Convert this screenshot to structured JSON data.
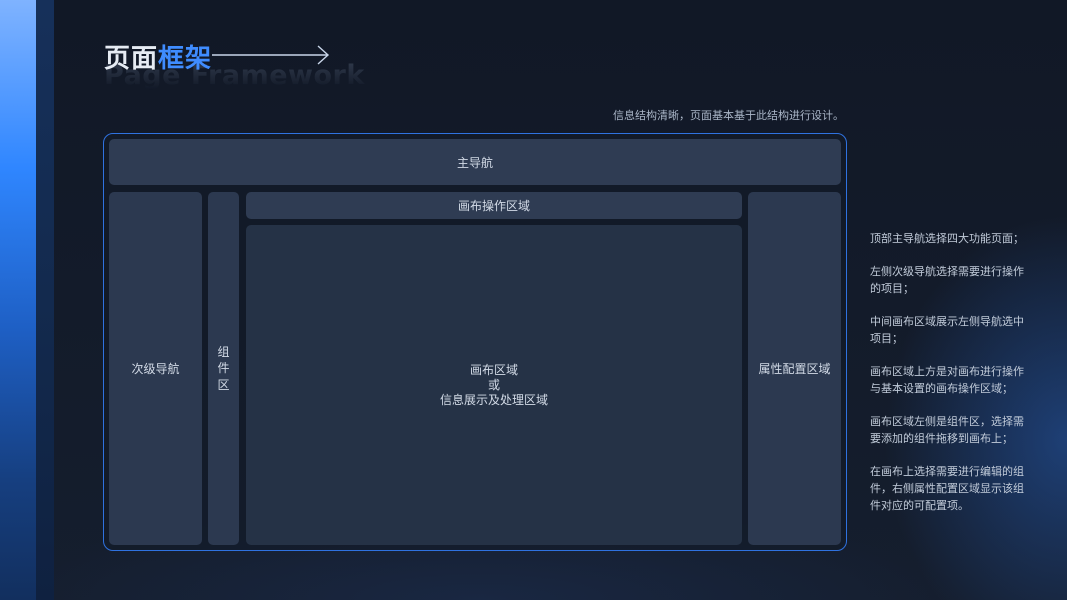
{
  "header": {
    "title_part1": "页面",
    "title_part2": "框架",
    "title_en": "Page Framework",
    "subtitle": "信息结构清晰，页面基本基于此结构进行设计。"
  },
  "diagram": {
    "main_nav": "主导航",
    "sub_nav": "次级导航",
    "component_area": "组\n件\n区",
    "canvas_ops": "画布操作区域",
    "canvas_line1": "画布区域",
    "canvas_line2": "或",
    "canvas_line3": "信息展示及处理区域",
    "props_area": "属性配置区域"
  },
  "notes": [
    "顶部主导航选择四大功能页面；",
    "左侧次级导航选择需要进行操作的项目；",
    "中间画布区域展示左侧导航选中项目；",
    "画布区域上方是对画布进行操作与基本设置的画布操作区域；",
    "画布区域左侧是组件区，选择需要添加的组件拖移到画布上；",
    "在画布上选择需要进行编辑的组件，右侧属性配置区域显示该组件对应的可配置项。"
  ],
  "colors": {
    "accent": "#3f8cff",
    "frame_border": "#2f72e0",
    "block": "#2f3c53",
    "background": "#121a28"
  }
}
